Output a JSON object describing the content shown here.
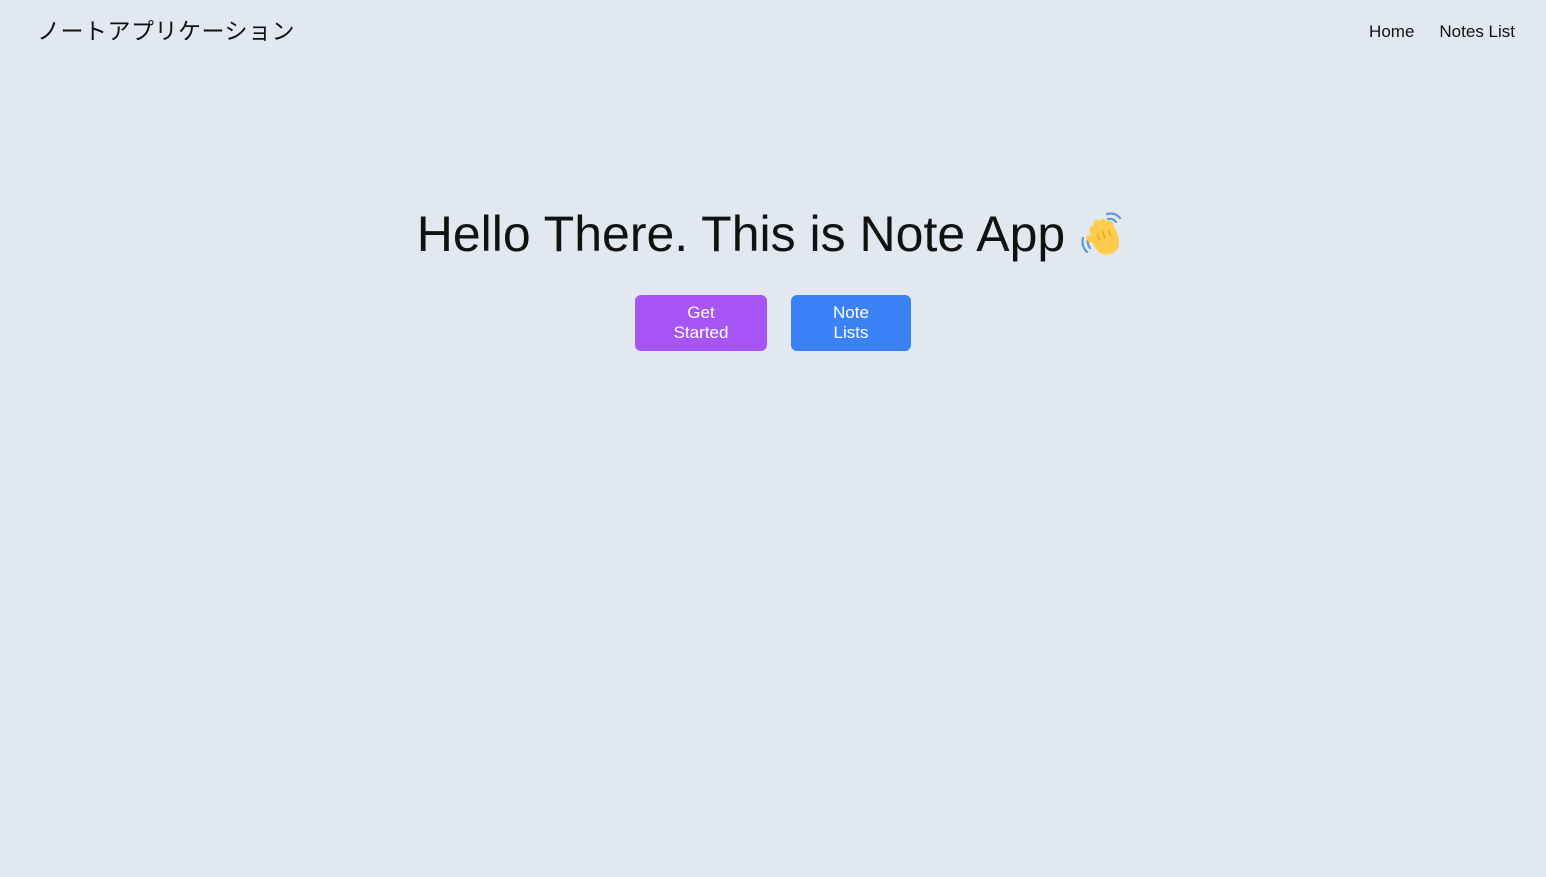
{
  "navbar": {
    "brand": "ノートアプリケーション",
    "links": [
      {
        "label": "Home"
      },
      {
        "label": "Notes List"
      }
    ]
  },
  "hero": {
    "title": "Hello There. This is Note App",
    "icon": "waving-hand-icon"
  },
  "actions": {
    "get_started_label": "Get Started",
    "note_lists_label": "Note Lists"
  },
  "colors": {
    "background": "#e2e8f0",
    "primary_purple": "#a855f7",
    "primary_blue": "#3b82f6",
    "text": "#111111"
  }
}
